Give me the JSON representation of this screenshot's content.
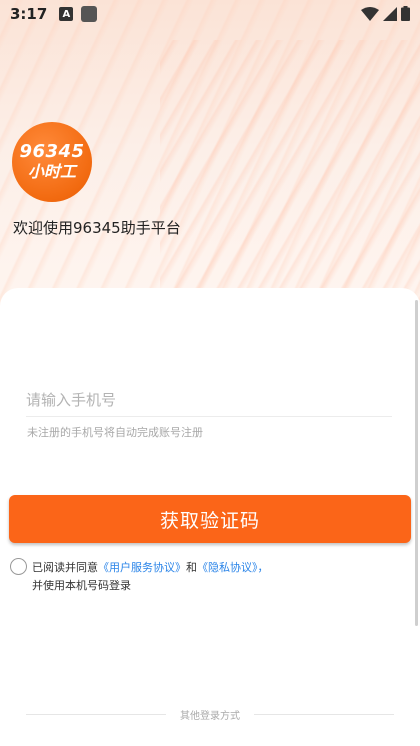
{
  "status_bar": {
    "time": "3:17",
    "left_icons": [
      "a-icon",
      "square-icon"
    ],
    "right_icons": [
      "wifi-icon",
      "signal-icon",
      "battery-icon"
    ]
  },
  "logo": {
    "number_text": "96345",
    "sub_text": "小时工",
    "color": "#f26a10"
  },
  "welcome_text": "欢迎使用96345助手平台",
  "form": {
    "phone_placeholder": "请输入手机号",
    "phone_value": "",
    "hint": "未注册的手机号将自动完成账号注册"
  },
  "submit_button": {
    "label": "获取验证码",
    "color": "#fb6518"
  },
  "agreement": {
    "prefix": "已阅读并同意",
    "user_agreement": "《用户服务协议》",
    "and": "和",
    "privacy_policy": "《隐私协议》",
    "suffix": "，",
    "line2": "并使用本机号码登录",
    "link_color": "#2a84e8"
  },
  "other_login": {
    "label": "其他登录方式"
  }
}
